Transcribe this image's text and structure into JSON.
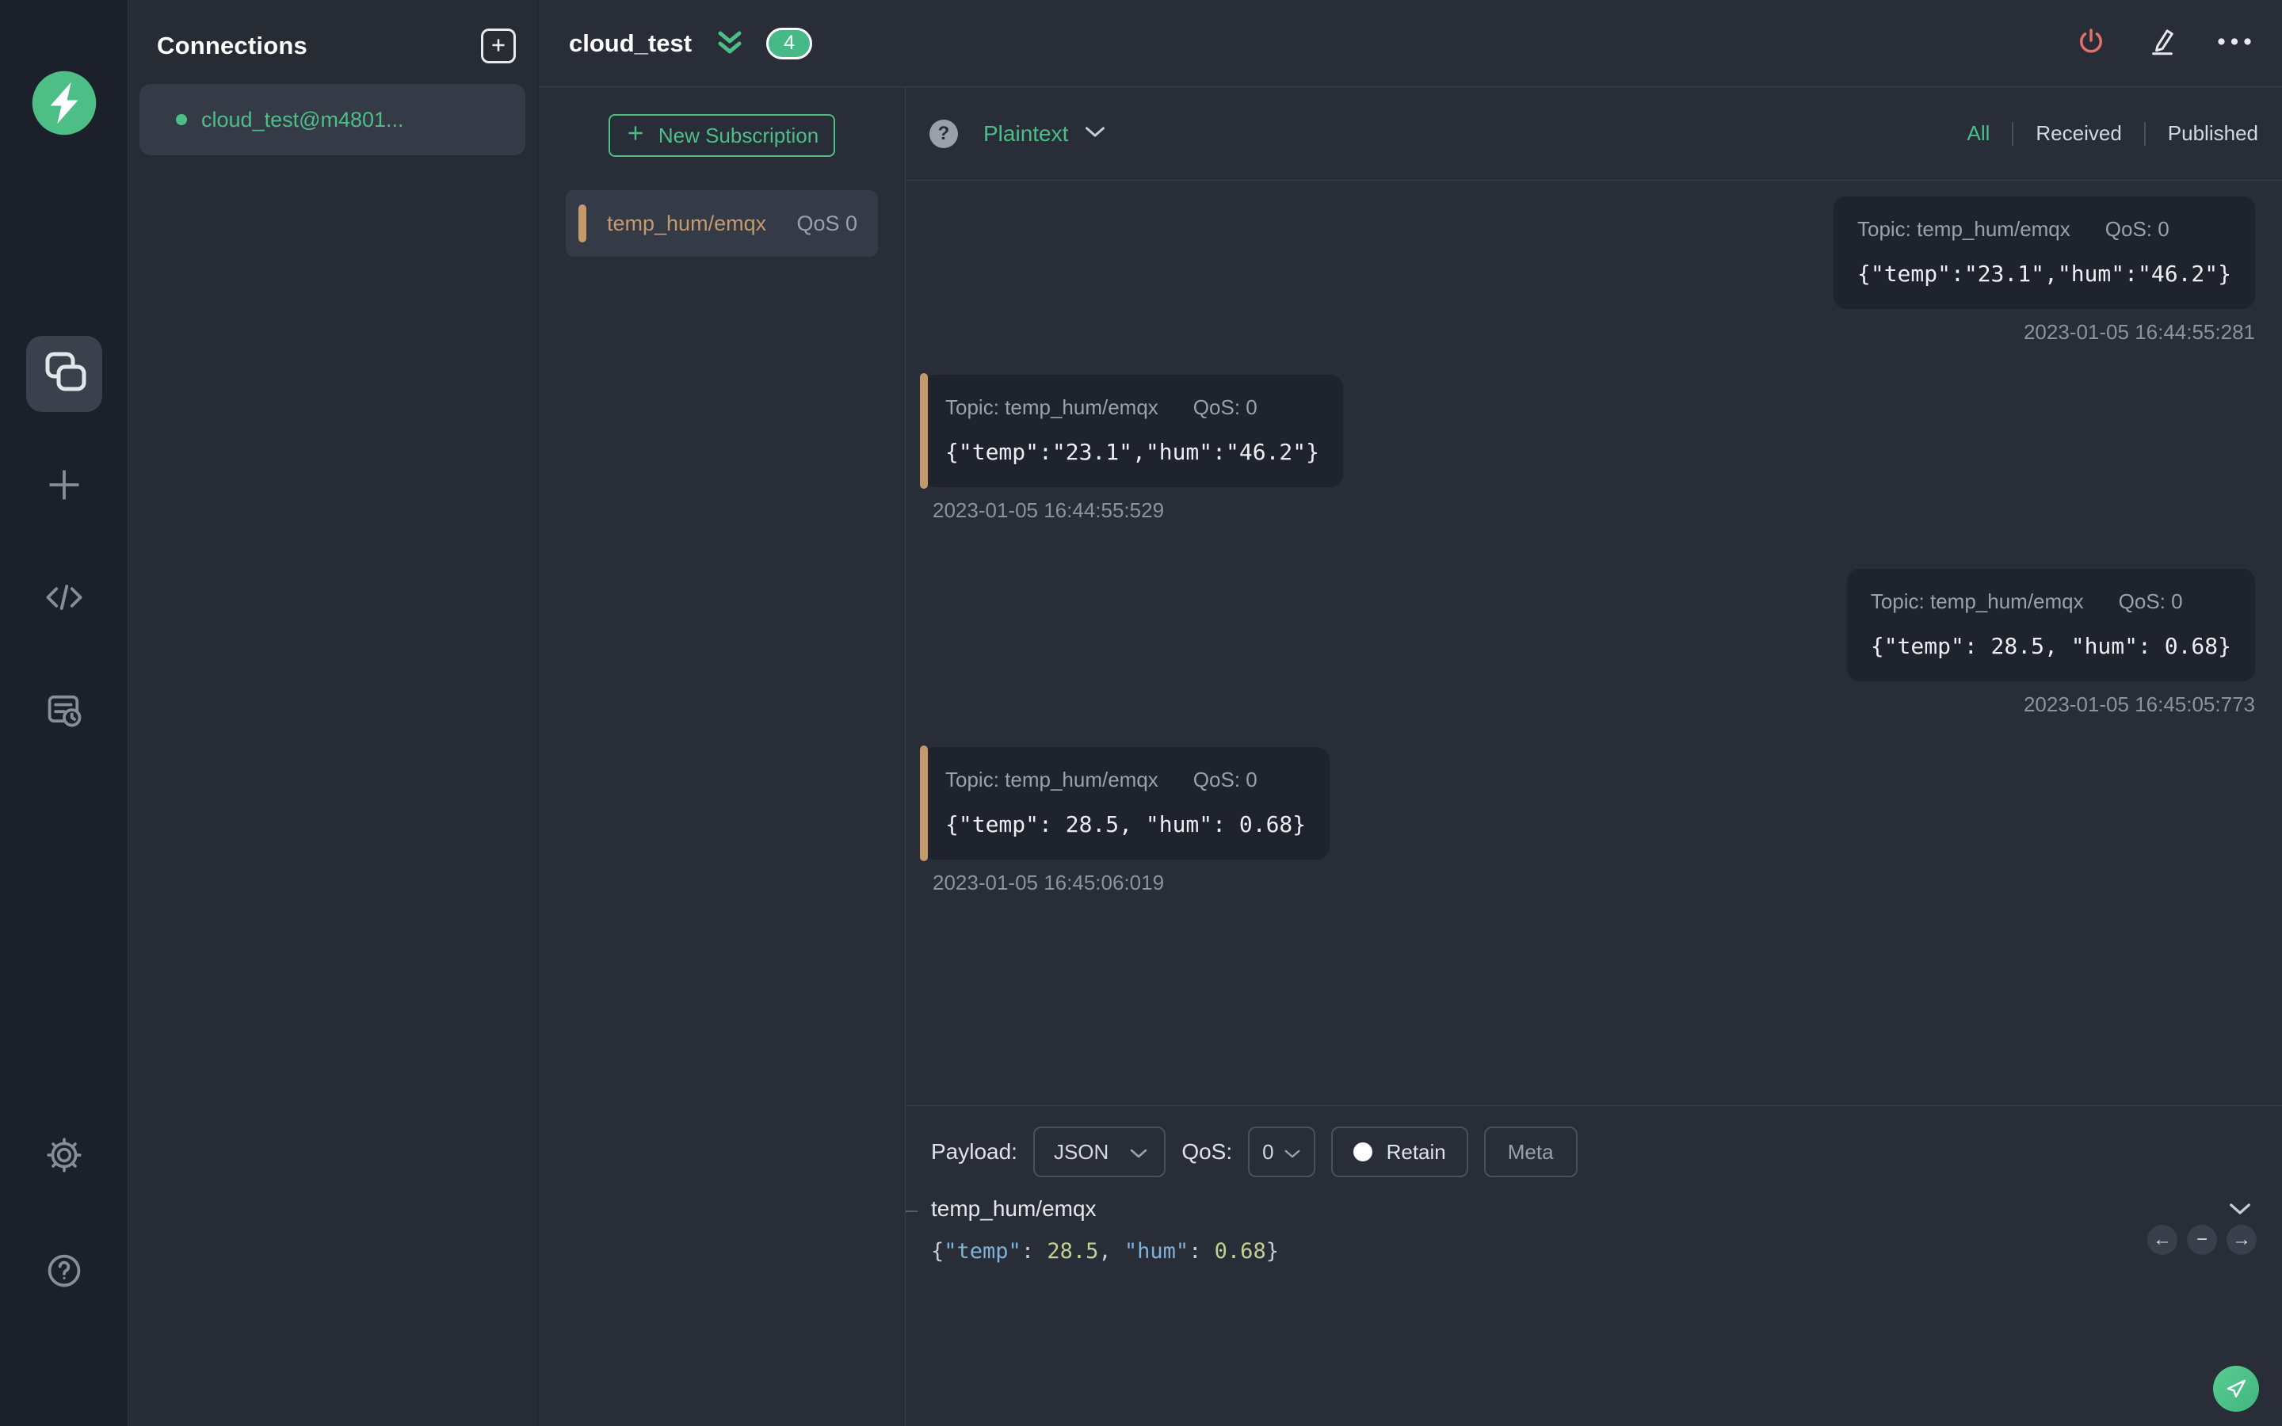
{
  "colors": {
    "accent": "#4ebe87",
    "badge": "#46b987",
    "tan": "#c49a6d",
    "red": "#e0716d",
    "bg-main": "#282d37",
    "bg-side": "#1c202a",
    "bg-panel": "#262b34",
    "bg-item": "#343a46",
    "bg-bubble": "#1f232d",
    "tok-key": "#7db4da",
    "tok-num": "#c2d193",
    "tok-punct": "#c6cbd4"
  },
  "connections": {
    "title": "Connections",
    "items": [
      {
        "name": "cloud_test@m4801...",
        "status": "connected"
      }
    ]
  },
  "topbar": {
    "title": "cloud_test",
    "unread_badge": "4"
  },
  "subscriptions": {
    "new_button_label": "New Subscription",
    "items": [
      {
        "topic": "temp_hum/emqx",
        "qos": "QoS 0"
      }
    ]
  },
  "messages": {
    "format_label": "Plaintext",
    "tabs": [
      {
        "label": "All",
        "active": true
      },
      {
        "label": "Received",
        "active": false
      },
      {
        "label": "Published",
        "active": false
      }
    ],
    "items": [
      {
        "direction": "published",
        "topic_label": "Topic: temp_hum/emqx",
        "qos_label": "QoS: 0",
        "payload": "{\"temp\":\"23.1\",\"hum\":\"46.2\"}",
        "timestamp": "2023-01-05 16:44:55:281"
      },
      {
        "direction": "received",
        "topic_label": "Topic: temp_hum/emqx",
        "qos_label": "QoS: 0",
        "payload": "{\"temp\":\"23.1\",\"hum\":\"46.2\"}",
        "timestamp": "2023-01-05 16:44:55:529"
      },
      {
        "direction": "published",
        "topic_label": "Topic: temp_hum/emqx",
        "qos_label": "QoS: 0",
        "payload": "{\"temp\": 28.5, \"hum\": 0.68}",
        "timestamp": "2023-01-05 16:45:05:773"
      },
      {
        "direction": "received",
        "topic_label": "Topic: temp_hum/emqx",
        "qos_label": "QoS: 0",
        "payload": "{\"temp\": 28.5, \"hum\": 0.68}",
        "timestamp": "2023-01-05 16:45:06:019"
      }
    ]
  },
  "publish": {
    "payload_label": "Payload:",
    "payload_format": "JSON",
    "qos_label": "QoS:",
    "qos_value": "0",
    "retain_label": "Retain",
    "meta_label": "Meta",
    "topic_value": "temp_hum/emqx",
    "editor_tokens": [
      {
        "text": "{",
        "type": "punct"
      },
      {
        "text": "\"temp\"",
        "type": "key"
      },
      {
        "text": ": ",
        "type": "punct"
      },
      {
        "text": "28.5",
        "type": "num"
      },
      {
        "text": ", ",
        "type": "punct"
      },
      {
        "text": "\"hum\"",
        "type": "key"
      },
      {
        "text": ": ",
        "type": "punct"
      },
      {
        "text": "0.68",
        "type": "num"
      },
      {
        "text": "}",
        "type": "punct"
      }
    ]
  }
}
